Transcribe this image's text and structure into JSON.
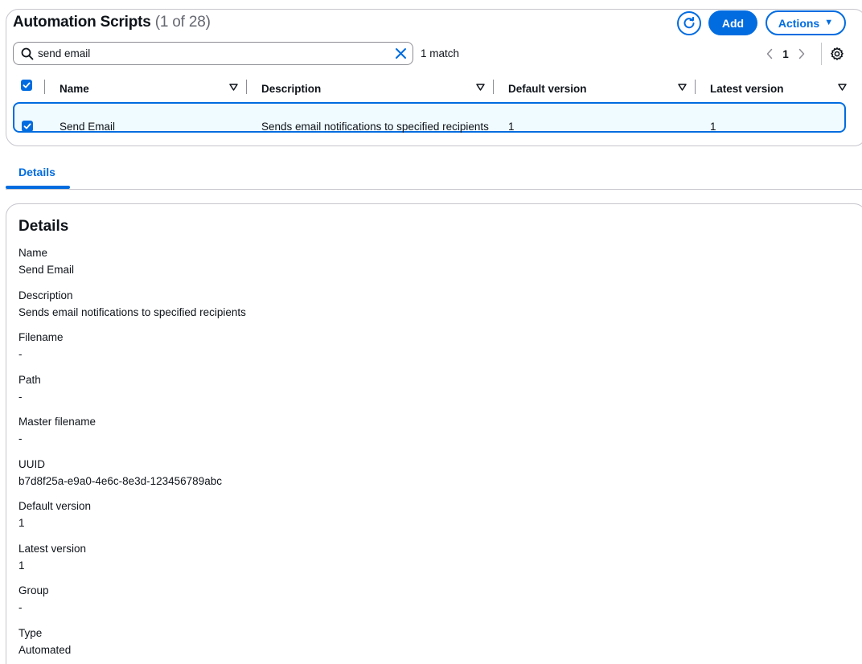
{
  "header": {
    "title": "Automation Scripts",
    "count": "(1 of 28)",
    "add_label": "Add",
    "actions_label": "Actions"
  },
  "search": {
    "value": "send email",
    "placeholder": "",
    "match_text": "1 match"
  },
  "pagination": {
    "current_page": "1"
  },
  "table": {
    "columns": [
      "Name",
      "Description",
      "Default version",
      "Latest version"
    ],
    "rows": [
      {
        "name": "Send Email",
        "description": "Sends email notifications to specified recipients",
        "default_version": "1",
        "latest_version": "1",
        "selected": true
      }
    ]
  },
  "tabs": [
    {
      "label": "Details",
      "active": true
    }
  ],
  "details": {
    "heading": "Details",
    "fields": [
      {
        "label": "Name",
        "value": "Send Email"
      },
      {
        "label": "Description",
        "value": "Sends email notifications to specified recipients"
      },
      {
        "label": "Filename",
        "value": "-"
      },
      {
        "label": "Path",
        "value": "-"
      },
      {
        "label": "Master filename",
        "value": "-"
      },
      {
        "label": "UUID",
        "value": "b7d8f25a-e9a0-4e6c-8e3d-123456789abc"
      },
      {
        "label": "Default version",
        "value": "1"
      },
      {
        "label": "Latest version",
        "value": "1"
      },
      {
        "label": "Group",
        "value": "-"
      },
      {
        "label": "Type",
        "value": "Automated"
      }
    ]
  },
  "colors": {
    "accent": "#006ce0",
    "row_selected_bg": "#f0fbff",
    "border": "#c6c6cd"
  },
  "icons": {
    "refresh": "refresh-icon",
    "search": "search-icon",
    "clear": "close-icon",
    "settings": "gear-icon",
    "sort": "sort-down-icon",
    "checkbox": "checkbox-checked-icon"
  }
}
